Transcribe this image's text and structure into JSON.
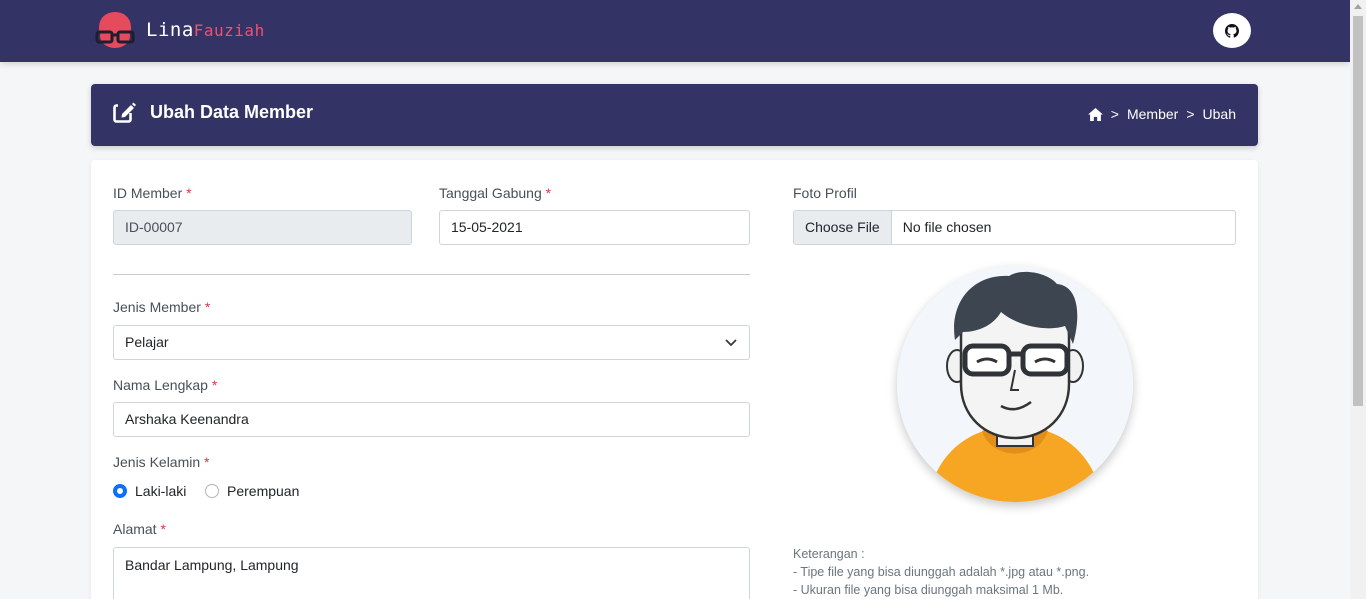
{
  "brand": {
    "name": "Lina",
    "accent": "Fauziah",
    "accent_color": "#f4506a",
    "bg_color": "#333366"
  },
  "navbar": {
    "github_icon": "github-icon"
  },
  "header": {
    "title": "Ubah Data Member",
    "icon": "edit-icon",
    "breadcrumb": {
      "home_icon": "home-icon",
      "separator": ">",
      "items": [
        "Member",
        "Ubah"
      ]
    }
  },
  "form": {
    "id_member": {
      "label": "ID Member",
      "value": "ID-00007"
    },
    "tanggal_gabung": {
      "label": "Tanggal Gabung",
      "value": "15-05-2021"
    },
    "jenis_member": {
      "label": "Jenis Member",
      "value": "Pelajar"
    },
    "nama_lengkap": {
      "label": "Nama Lengkap",
      "value": "Arshaka Keenandra"
    },
    "jenis_kelamin": {
      "label": "Jenis Kelamin",
      "options": [
        "Laki-laki",
        "Perempuan"
      ],
      "selected": "Laki-laki"
    },
    "alamat": {
      "label": "Alamat",
      "value": "Bandar Lampung, Lampung"
    },
    "foto_profil": {
      "label": "Foto Profil",
      "button": "Choose File",
      "status": "No file chosen"
    },
    "required_mark": "*"
  },
  "note": {
    "title": "Keterangan :",
    "lines": [
      "- Tipe file yang bisa diunggah adalah *.jpg atau *.png.",
      "- Ukuran file yang bisa diunggah maksimal 1 Mb."
    ]
  }
}
